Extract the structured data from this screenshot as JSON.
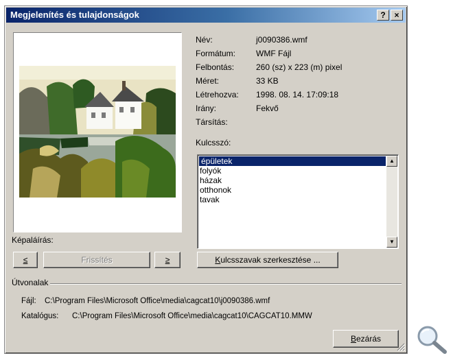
{
  "window": {
    "title": "Megjelenítés és tulajdonságok",
    "help_label": "?",
    "close_label": "×"
  },
  "properties": {
    "name_label": "Név:",
    "name_value": "j0090386.wmf",
    "format_label": "Formátum:",
    "format_value": "WMF Fájl",
    "resolution_label": "Felbontás:",
    "resolution_value": "260 (sz) x 223 (m) pixel",
    "size_label": "Méret:",
    "size_value": "33 KB",
    "created_label": "Létrehozva:",
    "created_value": "1998. 08. 14. 17:09:18",
    "orientation_label": "Irány:",
    "orientation_value": "Fekvő",
    "association_label": "Társítás:"
  },
  "keywords": {
    "label": "Kulcsszó:",
    "items": [
      "épületek",
      "folyók",
      "házak",
      "otthonok",
      "tavak"
    ],
    "selected": "épületek"
  },
  "caption": {
    "label": "Képaláírás:"
  },
  "buttons": {
    "prev": "≤",
    "refresh": "Frissítés",
    "next": "≥",
    "edit_keywords_accel": "K",
    "edit_keywords_rest": "ulcsszavak szerkesztése ...",
    "close_accel": "B",
    "close_rest": "ezárás"
  },
  "paths": {
    "group_label": "Útvonalak",
    "file_label": "Fájl:",
    "file_value": "C:\\Program Files\\Microsoft Office\\media\\cagcat10\\j0090386.wmf",
    "catalog_label": "Katalógus:",
    "catalog_value": "C:\\Program Files\\Microsoft Office\\media\\cagcat10\\CAGCAT10.MMW"
  },
  "icons": {
    "preview_image": "house-by-lake-clipart",
    "magnifier": "magnifier-icon",
    "grip": "resize-grip-icon"
  },
  "colors": {
    "title_gradient_start": "#0a246a",
    "title_gradient_end": "#a6caf0",
    "selection": "#0a246a",
    "face": "#d4d0c8"
  }
}
